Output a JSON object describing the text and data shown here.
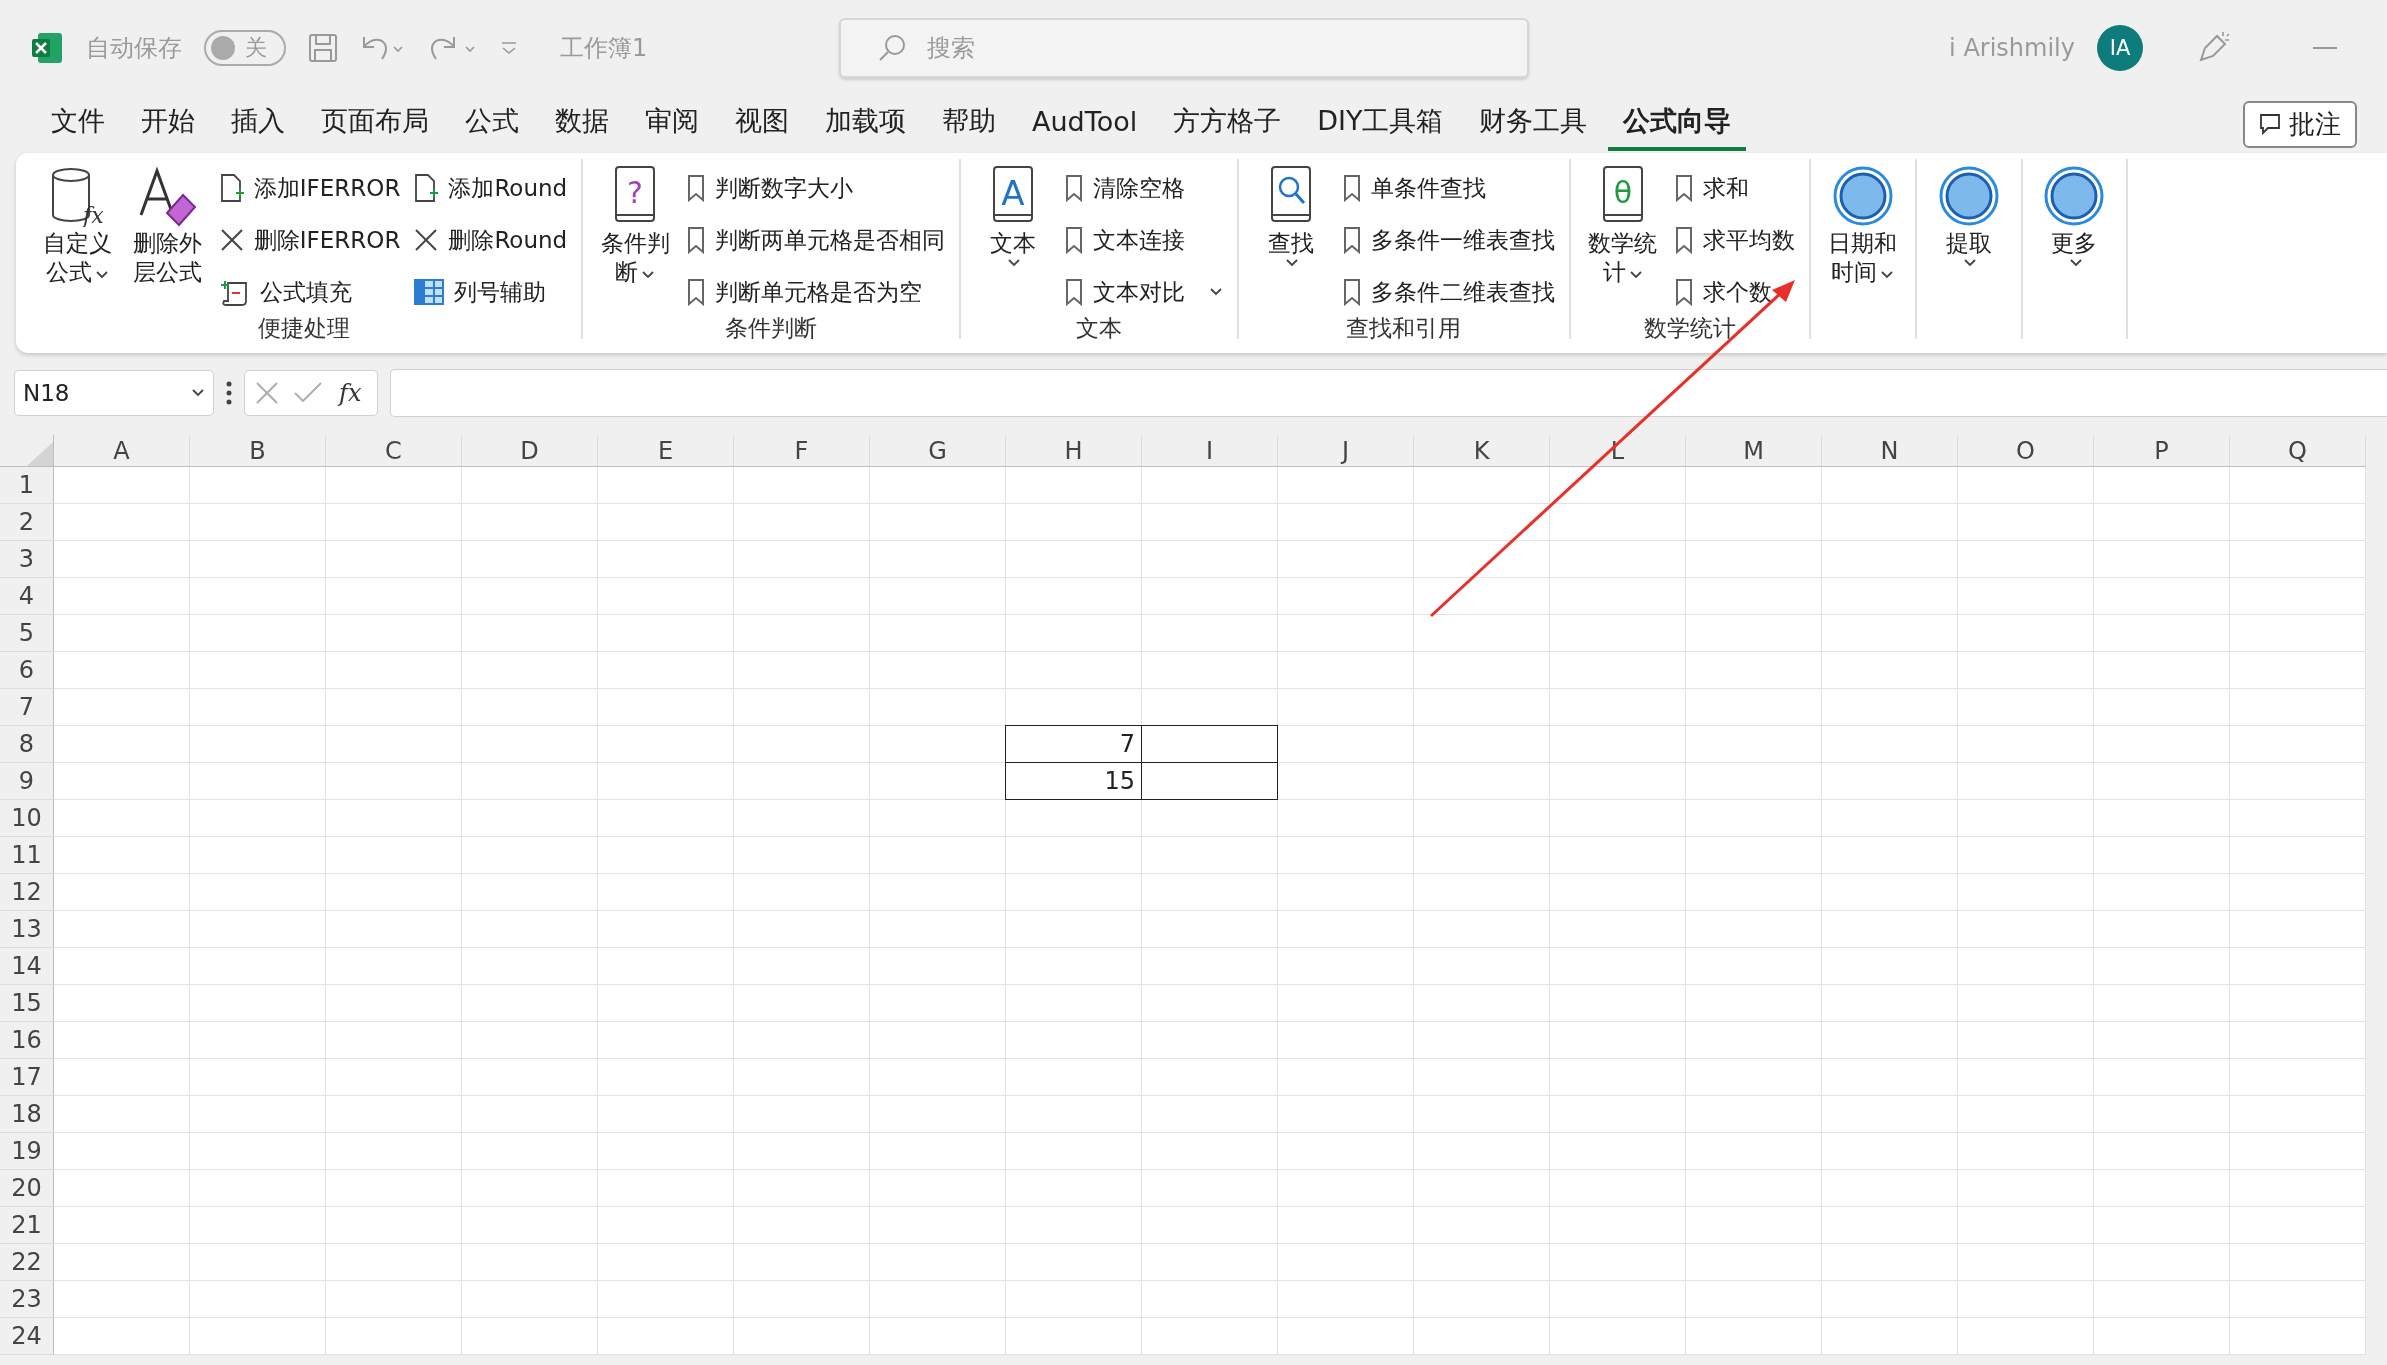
{
  "title_bar": {
    "autosave_label": "自动保存",
    "autosave_toggle": {
      "on": false,
      "label": "关"
    },
    "document_title": "工作簿1",
    "search": {
      "placeholder": "搜索"
    },
    "user_name": "i Arishmily",
    "avatar_initials": "IA"
  },
  "menu_tabs": [
    {
      "label": "文件",
      "selected": false
    },
    {
      "label": "开始",
      "selected": false
    },
    {
      "label": "插入",
      "selected": false
    },
    {
      "label": "页面布局",
      "selected": false
    },
    {
      "label": "公式",
      "selected": false
    },
    {
      "label": "数据",
      "selected": false
    },
    {
      "label": "审阅",
      "selected": false
    },
    {
      "label": "视图",
      "selected": false
    },
    {
      "label": "加载项",
      "selected": false
    },
    {
      "label": "帮助",
      "selected": false
    },
    {
      "label": "AudTool",
      "selected": false
    },
    {
      "label": "方方格子",
      "selected": false
    },
    {
      "label": "DIY工具箱",
      "selected": false
    },
    {
      "label": "财务工具",
      "selected": false
    },
    {
      "label": "公式向导",
      "selected": true
    }
  ],
  "comment_button": "批注",
  "ribbon_groups": [
    {
      "label": "便捷处理",
      "large_buttons": [
        {
          "label": "自定义公式",
          "dropdown": true,
          "icon_text": "fx"
        },
        {
          "label": "删除外层公式",
          "dropdown": false
        }
      ],
      "columns": [
        [
          {
            "label": "添加IFERROR"
          },
          {
            "label": "删除IFERROR"
          },
          {
            "label": "公式填充"
          }
        ],
        [
          {
            "label": "添加Round"
          },
          {
            "label": "删除Round"
          },
          {
            "label": "列号辅助"
          }
        ]
      ]
    },
    {
      "label": "条件判断",
      "large_buttons": [
        {
          "label": "条件判断",
          "dropdown": true,
          "icon_text": "?"
        }
      ],
      "columns": [
        [
          {
            "label": "判断数字大小"
          },
          {
            "label": "判断两单元格是否相同"
          },
          {
            "label": "判断单元格是否为空"
          }
        ]
      ]
    },
    {
      "label": "文本",
      "large_buttons": [
        {
          "label": "文本",
          "dropdown": true,
          "icon_text": "A"
        }
      ],
      "columns": [
        [
          {
            "label": "清除空格"
          },
          {
            "label": "文本连接"
          },
          {
            "label": "文本对比",
            "dropdown": true
          }
        ]
      ]
    },
    {
      "label": "查找和引用",
      "large_buttons": [
        {
          "label": "查找",
          "dropdown": true
        }
      ],
      "columns": [
        [
          {
            "label": "单条件查找"
          },
          {
            "label": "多条件一维表查找"
          },
          {
            "label": "多条件二维表查找"
          }
        ]
      ]
    },
    {
      "label": "数学统计",
      "large_buttons": [
        {
          "label": "数学统计",
          "dropdown": true,
          "icon_text": "θ"
        }
      ],
      "columns": [
        [
          {
            "label": "求和"
          },
          {
            "label": "求平均数"
          },
          {
            "label": "求个数"
          }
        ]
      ]
    },
    {
      "large_buttons": [
        {
          "label": "日期和时间",
          "dropdown": true
        }
      ]
    },
    {
      "large_buttons": [
        {
          "label": "提取",
          "dropdown": true
        }
      ]
    },
    {
      "large_buttons": [
        {
          "label": "更多",
          "dropdown": true
        }
      ]
    }
  ],
  "formula_bar": {
    "name_box": "N18",
    "function_symbol": "fx"
  },
  "sheet": {
    "columns": [
      "A",
      "B",
      "C",
      "D",
      "E",
      "F",
      "G",
      "H",
      "I",
      "J",
      "K",
      "L",
      "M",
      "N",
      "O",
      "P",
      "Q"
    ],
    "rows": [
      {
        "header": "1"
      },
      {
        "header": "2"
      },
      {
        "header": "3"
      },
      {
        "header": "4"
      },
      {
        "header": "5"
      },
      {
        "header": "6"
      },
      {
        "header": "7"
      },
      {
        "header": "8",
        "cells": [
          {
            "bordered": false
          },
          {
            "bordered": false
          },
          {
            "bordered": false
          },
          {
            "bordered": false
          },
          {
            "bordered": false
          },
          {
            "bordered": false
          },
          {
            "bordered": false
          },
          {
            "value": "7",
            "bordered": true
          },
          {
            "bordered": true
          }
        ]
      },
      {
        "header": "9",
        "cells": [
          {
            "bordered": false
          },
          {
            "bordered": false
          },
          {
            "bordered": false
          },
          {
            "bordered": false
          },
          {
            "bordered": false
          },
          {
            "bordered": false
          },
          {
            "bordered": false
          },
          {
            "value": "15",
            "bordered": true
          },
          {
            "bordered": true
          }
        ]
      },
      {
        "header": "10"
      },
      {
        "header": "11"
      },
      {
        "header": "12"
      },
      {
        "header": "13"
      },
      {
        "header": "14"
      },
      {
        "header": "15"
      },
      {
        "header": "16"
      },
      {
        "header": "17"
      },
      {
        "header": "18"
      },
      {
        "header": "19"
      },
      {
        "header": "20"
      },
      {
        "header": "21"
      },
      {
        "header": "22"
      },
      {
        "header": "23"
      },
      {
        "header": "24"
      }
    ]
  }
}
